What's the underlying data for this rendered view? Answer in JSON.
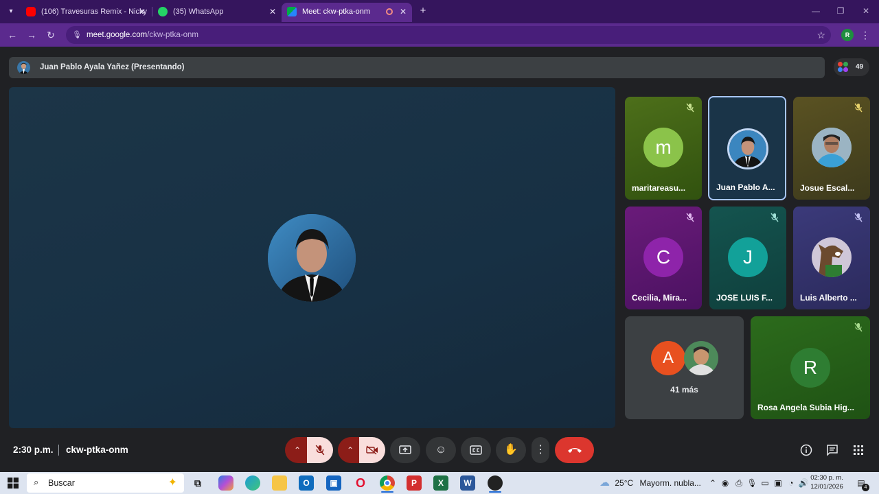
{
  "browser": {
    "tabs": [
      {
        "title": "(106) Travesuras Remix - Nicky",
        "favicon": "youtube-icon",
        "active": false
      },
      {
        "title": "(35) WhatsApp",
        "favicon": "whatsapp-icon",
        "active": false
      },
      {
        "title": "Meet: ckw-ptka-onm",
        "favicon": "meet-icon",
        "active": true
      }
    ],
    "address_host": "meet.google.com",
    "address_path": "/ckw-ptka-onm",
    "profile_initial": "R",
    "accent_color": "#5b2a8e"
  },
  "meet": {
    "presenter_banner": "Juan Pablo Ayala Yañez (Presentando)",
    "participant_count": "49",
    "tiles": [
      {
        "name": "maritareasu...",
        "initial": "m",
        "muted": true
      },
      {
        "name": "Juan Pablo A...",
        "initial": "",
        "muted": false,
        "speaking": true
      },
      {
        "name": "Josue Escal...",
        "initial": "",
        "muted": true
      },
      {
        "name": "Cecilia, Mira...",
        "initial": "C",
        "muted": true
      },
      {
        "name": "JOSE LUIS F...",
        "initial": "J",
        "muted": true
      },
      {
        "name": "Luis Alberto ...",
        "initial": "",
        "muted": true
      },
      {
        "name": "Rosa Angela Subia Hig...",
        "initial": "R",
        "muted": true
      }
    ],
    "more_initial": "A",
    "more_label": "41 más",
    "time": "2:30 p.m.",
    "meeting_code": "ckw-ptka-onm"
  },
  "taskbar": {
    "search_placeholder": "Buscar",
    "weather_temp": "25°C",
    "weather_text": "Mayorm. nubla...",
    "clock_time": "02:30 p. m.",
    "clock_date": "12/01/2026",
    "notification_count": "4"
  }
}
